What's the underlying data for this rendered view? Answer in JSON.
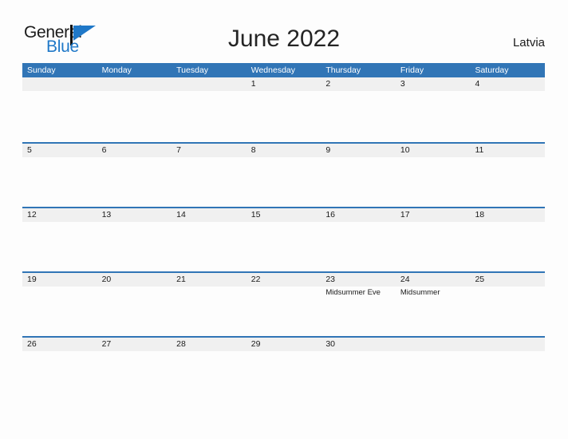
{
  "brand": {
    "name_part1": "General",
    "name_part2": "Blue",
    "logo_icon": "blue-flag-triangle-icon",
    "color_dark": "#1b1b1b",
    "color_blue": "#1f78c8"
  },
  "header": {
    "title": "June 2022",
    "country": "Latvia"
  },
  "theme": {
    "header_blue": "#3175b6",
    "row_divider_blue": "#3175b6",
    "date_band_gray": "#f0f0f0",
    "page_background": "#fdfdfd",
    "text_color": "#1a1a1a"
  },
  "calendar": {
    "month": "June",
    "year": "2022",
    "weekday_headers": [
      "Sunday",
      "Monday",
      "Tuesday",
      "Wednesday",
      "Thursday",
      "Friday",
      "Saturday"
    ],
    "weeks": [
      [
        {
          "day": "",
          "events": []
        },
        {
          "day": "",
          "events": []
        },
        {
          "day": "",
          "events": []
        },
        {
          "day": "1",
          "events": []
        },
        {
          "day": "2",
          "events": []
        },
        {
          "day": "3",
          "events": []
        },
        {
          "day": "4",
          "events": []
        }
      ],
      [
        {
          "day": "5",
          "events": []
        },
        {
          "day": "6",
          "events": []
        },
        {
          "day": "7",
          "events": []
        },
        {
          "day": "8",
          "events": []
        },
        {
          "day": "9",
          "events": []
        },
        {
          "day": "10",
          "events": []
        },
        {
          "day": "11",
          "events": []
        }
      ],
      [
        {
          "day": "12",
          "events": []
        },
        {
          "day": "13",
          "events": []
        },
        {
          "day": "14",
          "events": []
        },
        {
          "day": "15",
          "events": []
        },
        {
          "day": "16",
          "events": []
        },
        {
          "day": "17",
          "events": []
        },
        {
          "day": "18",
          "events": []
        }
      ],
      [
        {
          "day": "19",
          "events": []
        },
        {
          "day": "20",
          "events": []
        },
        {
          "day": "21",
          "events": []
        },
        {
          "day": "22",
          "events": []
        },
        {
          "day": "23",
          "events": [
            "Midsummer Eve"
          ]
        },
        {
          "day": "24",
          "events": [
            "Midsummer"
          ]
        },
        {
          "day": "25",
          "events": []
        }
      ],
      [
        {
          "day": "26",
          "events": []
        },
        {
          "day": "27",
          "events": []
        },
        {
          "day": "28",
          "events": []
        },
        {
          "day": "29",
          "events": []
        },
        {
          "day": "30",
          "events": []
        },
        {
          "day": "",
          "events": []
        },
        {
          "day": "",
          "events": []
        }
      ]
    ]
  }
}
